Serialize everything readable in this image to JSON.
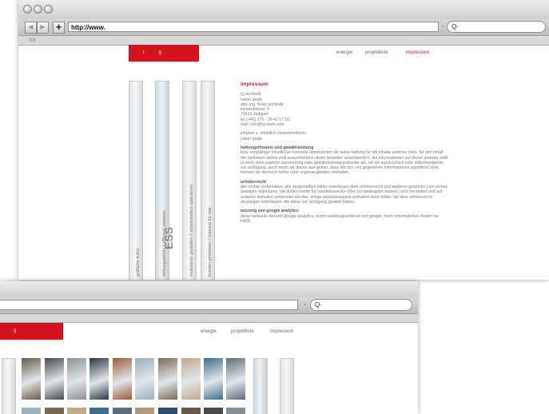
{
  "back_window": {
    "url": "http://www.",
    "search_placeholder": "Q-",
    "logo_text": "r g",
    "nav": [
      "energie",
      "projektliste",
      "impressum"
    ],
    "active_nav": "impressum",
    "strips": [
      "gräfliche kultur",
      "wirkungsfelder // efficient sanieren",
      "motivieren gestalten // arbeitswelten optimieren",
      "kunden gewinnen // impulse für das"
    ],
    "strip_big_text": "ESS",
    "impressum": {
      "title": "impressum",
      "address": [
        "rg architekt",
        "rainer guide",
        "dipl. ing. freier architekt",
        "kerwerblicker. 9",
        "79619 stuttgart",
        "tel (+49) 176 - 26 47 17 55",
        "mail: info@rg-work.com"
      ],
      "responsible_label": "inhaber u. inhaltlich verantwortliche:",
      "responsible_name": "rainer guide",
      "liability_heading": "haftungshinweis und gewährleistung",
      "liability_text": "trotz sorgfältiger inhaltlicher kontrolle übernehmen wir keine haftung für die inhalte externer links. für den inhalt der verlinkten seiten sind ausschließlich deren betreiber verantwortlich. die informationen auf dieser website stellt rs-work ohne jegliche zusicherung oder gewährleistung jedweder art, sei sie ausdrücklich oder stillschweigend, zur verfügung. auch wenn wir davon aus-gehen, dass die von uns gegebenen informationen zutreffend sind, können sie dennoch fehler oder ungenauigkeiten enthalten.",
      "copyright_heading": "urheberrecht",
      "copyright_text": "alle rechte vorbehalten. alle dargestellten bilder unterliegen dem urheberrecht und anderen gesetzen zum schutz geistigen eigentums. sie dürfen weder für handelszwecke oder zur weitergabe kopiert, noch verändert und auf anderen websites verwendet werden. einige arbeitsbeispiele enthalten auch bilder, die dem urheberrecht derjenigen unterliegen, die diese zur verfügung gestellt haben.",
      "analytics_heading": "nutzung von google analytics",
      "analytics_text": "diese webseite benutzt google analytics, einen webanalysedienst von google. mehr informationen finden sie HIER."
    }
  },
  "front_window": {
    "search_placeholder": "Q-",
    "logo_text": "g",
    "nav": [
      "energie",
      "projektliste",
      "impressum"
    ],
    "photo_colors": [
      "#6b5a48",
      "#4a4a4a",
      "#8a8f93",
      "#2e3a44",
      "#a05a36",
      "#9cb0bd",
      "#7a6a52",
      "#c4a88a",
      "#3c6e8e",
      "#5c6e7a",
      "#b49a78",
      "#2b4f6a"
    ]
  }
}
